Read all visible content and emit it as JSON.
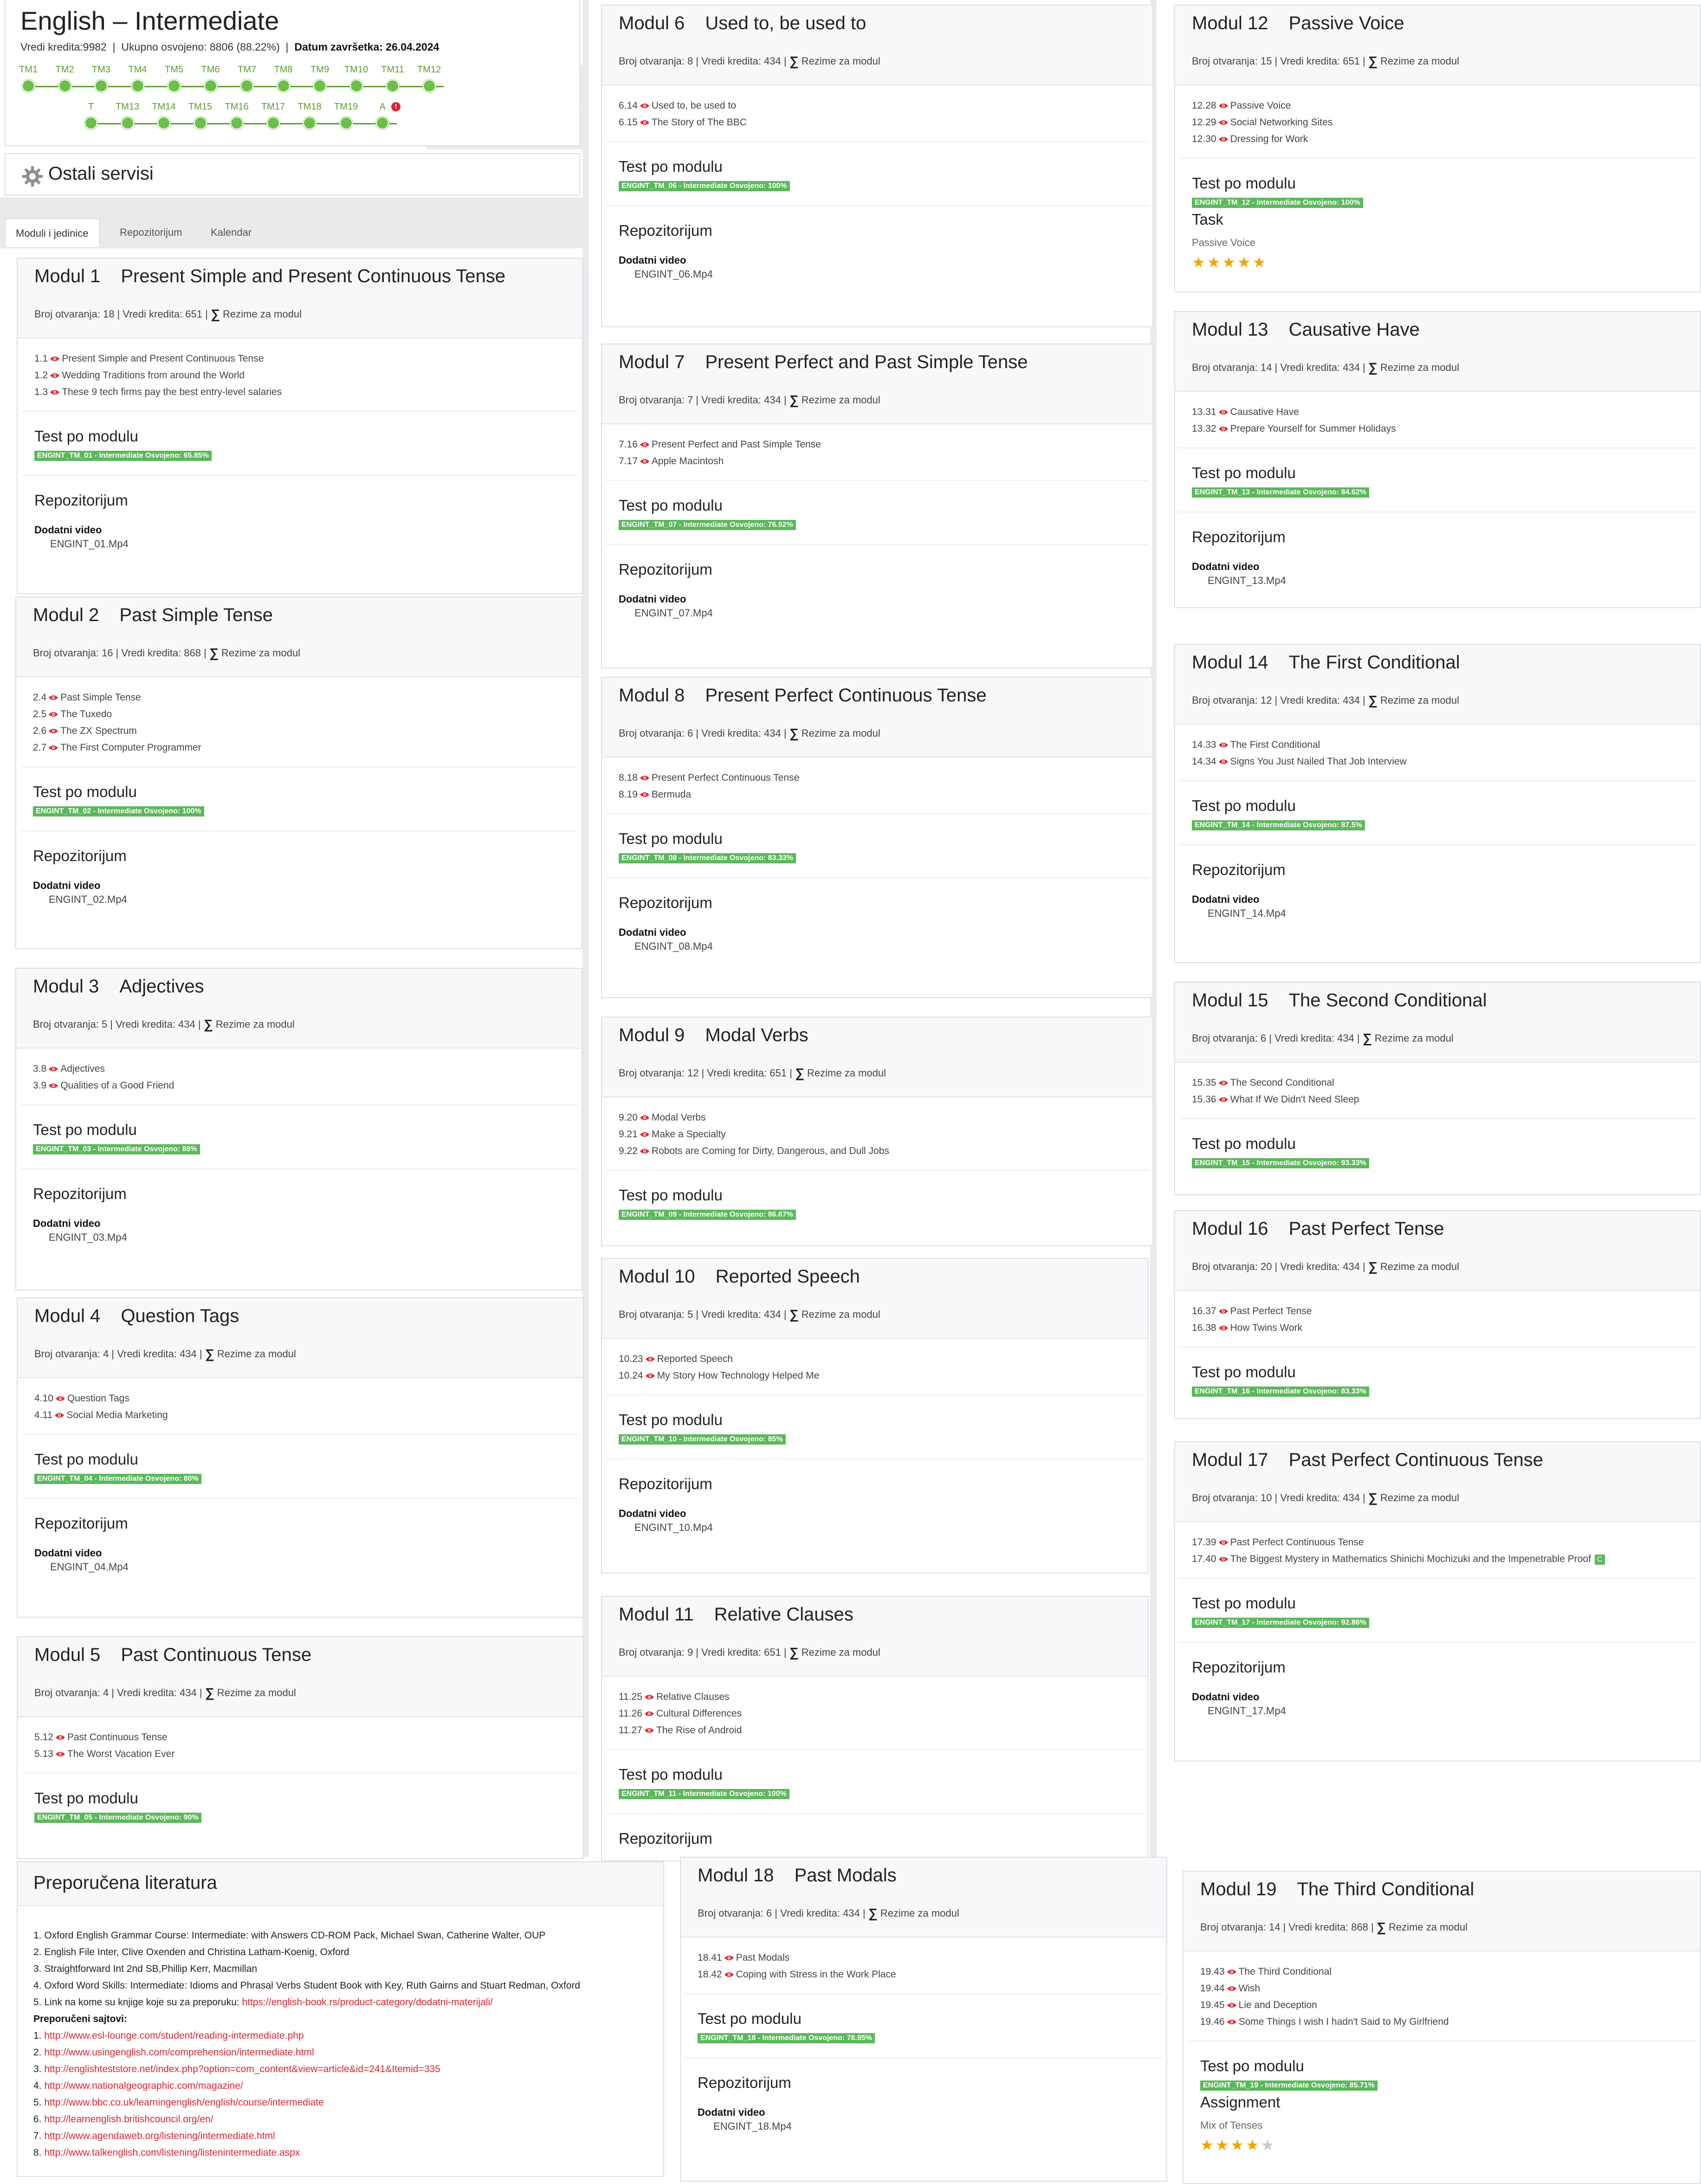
{
  "header": {
    "title": "English – Intermediate",
    "credits_label": "Vredi kredita:9982",
    "earned_label": "Ukupno osvojeno: 8806 (88.22%)",
    "deadline_label": "Datum završetka: 26.04.2024",
    "row1": [
      "TM1",
      "TM2",
      "TM3",
      "TM4",
      "TM5",
      "TM6",
      "TM7",
      "TM8",
      "TM9",
      "TM10",
      "TM11",
      "TM12"
    ],
    "row2": [
      "T",
      "TM13",
      "TM14",
      "TM15",
      "TM16",
      "TM17",
      "TM18",
      "TM19",
      "A"
    ],
    "warning_glyph": "!"
  },
  "services": {
    "title": "Ostali servisi"
  },
  "tabs": [
    "Moduli i jedinice",
    "Repozitorijum",
    "Kalendar"
  ],
  "labels": {
    "test": "Test po modulu",
    "repo": "Repozitorijum",
    "video": "Dodatni video",
    "sigma": "∑",
    "rezime": "Rezime za modul"
  },
  "modules": [
    {
      "num": "Modul 1",
      "title": "Present Simple and Present Continuous Tense",
      "meta": "Broj otvaranja: 18  |  Vredi kredita: 651 |",
      "units": [
        [
          "1.1",
          "Present Simple and Present Continuous Tense"
        ],
        [
          "1.2",
          "Wedding Traditions from around the World"
        ],
        [
          "1.3",
          "These 9 tech firms pay the best entry-level salaries"
        ]
      ],
      "badge": "ENGINT_TM_01 - Intermediate Osvojeno: 65.85%",
      "video": "ENGINT_01.Mp4"
    },
    {
      "num": "Modul 2",
      "title": "Past Simple Tense",
      "meta": "Broj otvaranja: 16  |  Vredi kredita: 868 |",
      "units": [
        [
          "2.4",
          "Past Simple Tense"
        ],
        [
          "2.5",
          "The Tuxedo"
        ],
        [
          "2.6",
          "The ZX Spectrum"
        ],
        [
          "2.7",
          "The First Computer Programmer"
        ]
      ],
      "badge": "ENGINT_TM_02 - Intermediate Osvojeno: 100%",
      "video": "ENGINT_02.Mp4"
    },
    {
      "num": "Modul 3",
      "title": "Adjectives",
      "meta": "Broj otvaranja: 5  |  Vredi kredita: 434 |",
      "units": [
        [
          "3.8",
          "Adjectives"
        ],
        [
          "3.9",
          "Qualities of a Good Friend"
        ]
      ],
      "badge": "ENGINT_TM_03 - Intermediate Osvojeno: 88%",
      "video": "ENGINT_03.Mp4"
    },
    {
      "num": "Modul 4",
      "title": "Question Tags",
      "meta": "Broj otvaranja: 4  |  Vredi kredita: 434 |",
      "units": [
        [
          "4.10",
          "Question Tags"
        ],
        [
          "4.11",
          "Social Media Marketing"
        ]
      ],
      "badge": "ENGINT_TM_04 - Intermediate Osvojeno: 80%",
      "video": "ENGINT_04.Mp4"
    },
    {
      "num": "Modul 5",
      "title": "Past Continuous Tense",
      "meta": "Broj otvaranja: 4  |  Vredi kredita: 434 |",
      "units": [
        [
          "5.12",
          "Past Continuous Tense"
        ],
        [
          "5.13",
          "The Worst Vacation Ever"
        ]
      ],
      "badge": "ENGINT_TM_05 - Intermediate Osvojeno: 90%"
    },
    {
      "num": "Modul 6",
      "title": "Used to, be used to",
      "meta": "Broj otvaranja: 8  |  Vredi kredita: 434 |",
      "units": [
        [
          "6.14",
          "Used to, be used to"
        ],
        [
          "6.15",
          "The Story of The BBC"
        ]
      ],
      "badge": "ENGINT_TM_06 - Intermediate Osvojeno: 100%",
      "video": "ENGINT_06.Mp4"
    },
    {
      "num": "Modul 7",
      "title": "Present Perfect and Past Simple Tense",
      "meta": "Broj otvaranja: 7  |  Vredi kredita: 434 |",
      "units": [
        [
          "7.16",
          "Present Perfect and Past Simple Tense"
        ],
        [
          "7.17",
          "Apple Macintosh"
        ]
      ],
      "badge": "ENGINT_TM_07 - Intermediate Osvojeno: 76.92%",
      "video": "ENGINT_07.Mp4"
    },
    {
      "num": "Modul 8",
      "title": "Present Perfect Continuous Tense",
      "meta": "Broj otvaranja: 6  |  Vredi kredita: 434 |",
      "units": [
        [
          "8.18",
          "Present Perfect Continuous Tense"
        ],
        [
          "8.19",
          "Bermuda"
        ]
      ],
      "badge": "ENGINT_TM_08 - Intermediate Osvojeno: 83.33%",
      "video": "ENGINT_08.Mp4"
    },
    {
      "num": "Modul 9",
      "title": "Modal Verbs",
      "meta": "Broj otvaranja: 12  |  Vredi kredita: 651 |",
      "units": [
        [
          "9.20",
          "Modal Verbs"
        ],
        [
          "9.21",
          "Make a Specialty"
        ],
        [
          "9.22",
          "Robots are Coming for Dirty, Dangerous, and Dull Jobs"
        ]
      ],
      "badge": "ENGINT_TM_09 - Intermediate Osvojeno: 86.67%"
    },
    {
      "num": "Modul 10",
      "title": "Reported Speech",
      "meta": "Broj otvaranja: 5  |  Vredi kredita: 434 |",
      "units": [
        [
          "10.23",
          "Reported Speech"
        ],
        [
          "10.24",
          "My Story How Technology Helped Me"
        ]
      ],
      "badge": "ENGINT_TM_10 - Intermediate Osvojeno: 85%",
      "video": "ENGINT_10.Mp4"
    },
    {
      "num": "Modul 11",
      "title": "Relative Clauses",
      "meta": "Broj otvaranja: 9  |  Vredi kredita: 651 |",
      "units": [
        [
          "11.25",
          "Relative Clauses"
        ],
        [
          "11.26",
          "Cultural Differences"
        ],
        [
          "11.27",
          "The Rise of Android"
        ]
      ],
      "badge": "ENGINT_TM_11 - Intermediate Osvojeno: 100%"
    },
    {
      "num": "Modul 12",
      "title": "Passive Voice",
      "meta": "Broj otvaranja: 15  |  Vredi kredita: 651 |",
      "units": [
        [
          "12.28",
          "Passive Voice"
        ],
        [
          "12.29",
          "Social Networking Sites"
        ],
        [
          "12.30",
          "Dressing for Work"
        ]
      ],
      "badge": "ENGINT_TM_12 - Intermediate Osvojeno: 100%",
      "task_title": "Task",
      "task_sub": "Passive Voice",
      "stars": 5
    },
    {
      "num": "Modul 13",
      "title": "Causative Have",
      "meta": "Broj otvaranja: 14  |  Vredi kredita: 434 |",
      "units": [
        [
          "13.31",
          "Causative Have"
        ],
        [
          "13.32",
          "Prepare Yourself for Summer Holidays"
        ]
      ],
      "badge": "ENGINT_TM_13 - Intermediate Osvojeno: 84.62%",
      "video": "ENGINT_13.Mp4"
    },
    {
      "num": "Modul 14",
      "title": "The First Conditional",
      "meta": "Broj otvaranja: 12  |  Vredi kredita: 434 |",
      "units": [
        [
          "14.33",
          "The First Conditional"
        ],
        [
          "14.34",
          "Signs You Just Nailed That Job Interview"
        ]
      ],
      "badge": "ENGINT_TM_14 - Intermediate Osvojeno: 87.5%",
      "video": "ENGINT_14.Mp4"
    },
    {
      "num": "Modul 15",
      "title": "The Second Conditional",
      "meta": "Broj otvaranja: 6  |  Vredi kredita: 434 |",
      "units": [
        [
          "15.35",
          "The Second Conditional"
        ],
        [
          "15.36",
          "What If We Didn't Need Sleep"
        ]
      ],
      "badge": "ENGINT_TM_15 - Intermediate Osvojeno: 93.33%"
    },
    {
      "num": "Modul 16",
      "title": "Past Perfect Tense",
      "meta": "Broj otvaranja: 20  |  Vredi kredita: 434 |",
      "units": [
        [
          "16.37",
          "Past Perfect Tense"
        ],
        [
          "16.38",
          "How Twins Work"
        ]
      ],
      "badge": "ENGINT_TM_16 - Intermediate Osvojeno: 83.33%"
    },
    {
      "num": "Modul 17",
      "title": "Past Perfect Continuous Tense",
      "meta": "Broj otvaranja: 10  |  Vredi kredita: 434 |",
      "units": [
        [
          "17.39",
          "Past Perfect Continuous Tense"
        ],
        [
          "17.40",
          "The Biggest Mystery in Mathematics Shinichi Mochizuki and the Impenetrable Proof"
        ]
      ],
      "extra_glyph": "C",
      "badge": "ENGINT_TM_17 - Intermediate Osvojeno: 92.86%",
      "video": "ENGINT_17.Mp4"
    },
    {
      "num": "Modul 18",
      "title": "Past Modals",
      "meta": "Broj otvaranja: 6  |  Vredi kredita: 434 |",
      "units": [
        [
          "18.41",
          "Past Modals"
        ],
        [
          "18.42",
          "Coping with Stress in the Work Place"
        ]
      ],
      "badge": "ENGINT_TM_18 - Intermediate Osvojeno: 78.95%",
      "video": "ENGINT_18.Mp4"
    },
    {
      "num": "Modul 19",
      "title": "The Third Conditional",
      "meta": "Broj otvaranja: 14  |  Vredi kredita: 868 |",
      "units": [
        [
          "19.43",
          "The Third Conditional"
        ],
        [
          "19.44",
          "Wish"
        ],
        [
          "19.45",
          "Lie and Deception"
        ],
        [
          "19.46",
          "Some Things I wish I hadn't Said to My Girlfriend"
        ]
      ],
      "badge": "ENGINT_TM_19 - Intermediate Osvojeno: 85.71%",
      "task_title": "Assignment",
      "task_sub": "Mix of Tenses",
      "stars": 4
    }
  ],
  "literature": {
    "title": "Preporučena literatura",
    "books": [
      "1. Oxford English Grammar Course: Intermediate: with Answers CD-ROM Pack, Michael Swan, Catherine Walter, OUP",
      "2. English File Inter, Clive Oxenden and Christina Latham-Koenig, Oxford",
      "3. Straightforward Int 2nd SB,Phillip Kerr, Macmillan",
      "4. Oxford Word Skills: Intermediate: Idioms and Phrasal Verbs Student Book with Key, Ruth Gairns and Stuart Redman, Oxford"
    ],
    "link_intro": "5. Link na kome su knjige koje su za preporuku:",
    "link_url": "https://english-book.rs/product-category/dodatni-materijali/",
    "sites_title": "Preporučeni sajtovi:",
    "sites": [
      "http://www.esl-lounge.com/student/reading-intermediate.php",
      "http://www.usingenglish.com/comprehension/intermediate.html",
      "http://englishteststore.net/index.php?option=com_content&view=article&id=241&Itemid=335",
      "http://www.nationalgeographic.com/magazine/",
      "http://www.bbc.co.uk/learningenglish/english/course/intermediate",
      "http://learnenglish.britishcouncil.org/en/",
      "http://www.agendaweb.org/listening/intermediate.html",
      "http://www.talkenglish.com/listening/listenintermediate.aspx"
    ]
  },
  "colors": {
    "accent_green": "#5cb85c",
    "link_red": "#d9262e",
    "eye_red": "#d9262e",
    "star": "#f0a500"
  }
}
